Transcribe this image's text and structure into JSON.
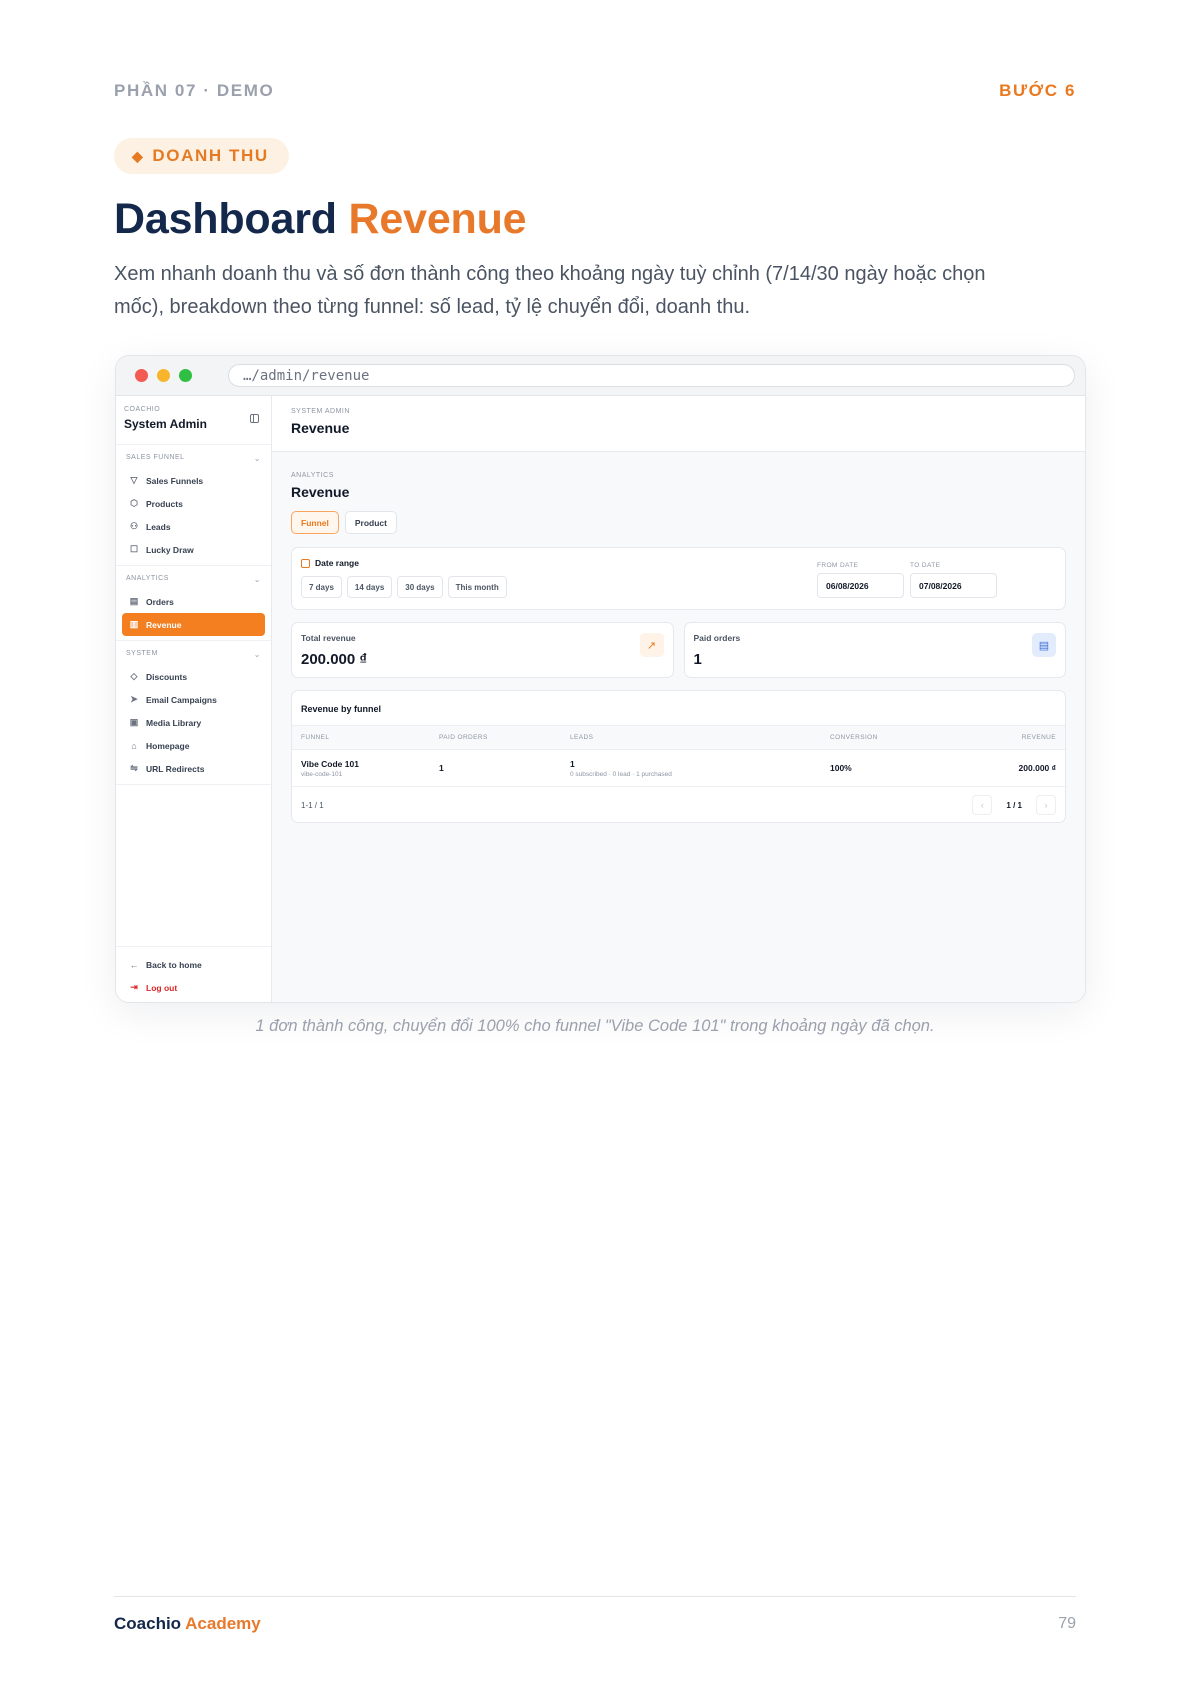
{
  "header": {
    "section": "PHẦN 07 · DEMO",
    "step": "BƯỚC 6"
  },
  "tag": {
    "icon": "diamond-icon",
    "label": "DOANH THU"
  },
  "title": {
    "main": "Dashboard",
    "accent": "Revenue"
  },
  "description": "Xem nhanh doanh thu và số đơn thành công theo khoảng ngày tuỳ chỉnh (7/14/30 ngày hoặc chọn mốc), breakdown theo từng funnel: số lead, tỷ lệ chuyển đổi, doanh thu.",
  "browser": {
    "url": "…/admin/revenue"
  },
  "sidebar": {
    "brand_small": "COACHIO",
    "brand": "System Admin",
    "sections": [
      {
        "title": "SALES FUNNEL",
        "items": [
          {
            "label": "Sales Funnels",
            "icon": "filter-icon"
          },
          {
            "label": "Products",
            "icon": "box-icon"
          },
          {
            "label": "Leads",
            "icon": "users-icon"
          },
          {
            "label": "Lucky Draw",
            "icon": "square-icon"
          }
        ]
      },
      {
        "title": "ANALYTICS",
        "items": [
          {
            "label": "Orders",
            "icon": "document-icon"
          },
          {
            "label": "Revenue",
            "icon": "bar-chart-icon",
            "active": true
          }
        ]
      },
      {
        "title": "SYSTEM",
        "items": [
          {
            "label": "Discounts",
            "icon": "tag-icon"
          },
          {
            "label": "Email Campaigns",
            "icon": "send-icon"
          },
          {
            "label": "Media Library",
            "icon": "image-icon"
          },
          {
            "label": "Homepage",
            "icon": "home-icon"
          },
          {
            "label": "URL Redirects",
            "icon": "redirect-icon"
          }
        ]
      }
    ],
    "back": "Back to home",
    "logout": "Log out"
  },
  "topbar": {
    "small": "SYSTEM ADMIN",
    "title": "Revenue"
  },
  "page": {
    "small": "ANALYTICS",
    "title": "Revenue",
    "tabs": [
      "Funnel",
      "Product"
    ],
    "active_tab": "Funnel"
  },
  "date_range": {
    "label": "Date range",
    "quick": [
      "7 days",
      "14 days",
      "30 days",
      "This month"
    ],
    "from_label": "FROM DATE",
    "from_value": "06/08/2026",
    "to_label": "TO DATE",
    "to_value": "07/08/2026"
  },
  "stats": {
    "total_revenue_label": "Total revenue",
    "total_revenue_value": "200.000 ₫",
    "paid_orders_label": "Paid orders",
    "paid_orders_value": "1"
  },
  "table": {
    "title": "Revenue by funnel",
    "columns": [
      "FUNNEL",
      "PAID ORDERS",
      "LEADS",
      "CONVERSION",
      "REVENUE"
    ],
    "rows": [
      {
        "funnel": "Vibe Code 101",
        "slug": "vibe-code-101",
        "paid_orders": "1",
        "leads": "1",
        "leads_detail": "0 subscribed · 0 lead · 1 purchased",
        "conversion": "100%",
        "revenue": "200.000 ₫"
      }
    ],
    "range": "1-1 / 1",
    "page": "1 / 1"
  },
  "caption": "1 đơn thành công, chuyển đổi 100% cho funnel \"Vibe Code 101\" trong khoảng ngày đã chọn.",
  "footer": {
    "brand": "Coachio",
    "brand_accent": "Academy",
    "page_number": "79"
  },
  "colors": {
    "accent": "#ea7a1f",
    "navy": "#14284b"
  }
}
